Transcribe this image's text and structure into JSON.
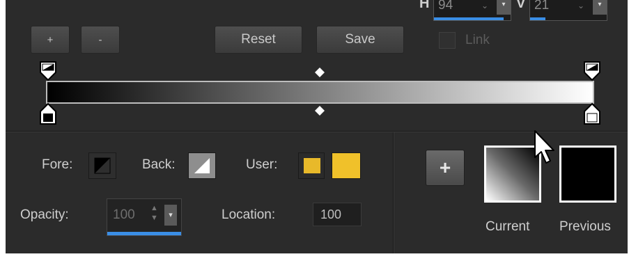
{
  "top": {
    "h_label": "H",
    "h_value": "94",
    "v_label": "V",
    "v_value": "21",
    "link_label": "Link"
  },
  "toolbar": {
    "add_label": "+",
    "remove_label": "-",
    "reset_label": "Reset",
    "save_label": "Save"
  },
  "gradient": {
    "start_color": "#000000",
    "end_color": "#ffffff"
  },
  "colors": {
    "fore_label": "Fore:",
    "back_label": "Back:",
    "user_label": "User:",
    "user_swatch_1": "#e8b92a",
    "user_swatch_2": "#f0c12a"
  },
  "opacity": {
    "label": "Opacity:",
    "value": "100"
  },
  "location": {
    "label": "Location:",
    "value": "100"
  },
  "preview": {
    "add_label": "+",
    "current_label": "Current",
    "previous_label": "Previous"
  },
  "accent_color": "#3a8ee6"
}
